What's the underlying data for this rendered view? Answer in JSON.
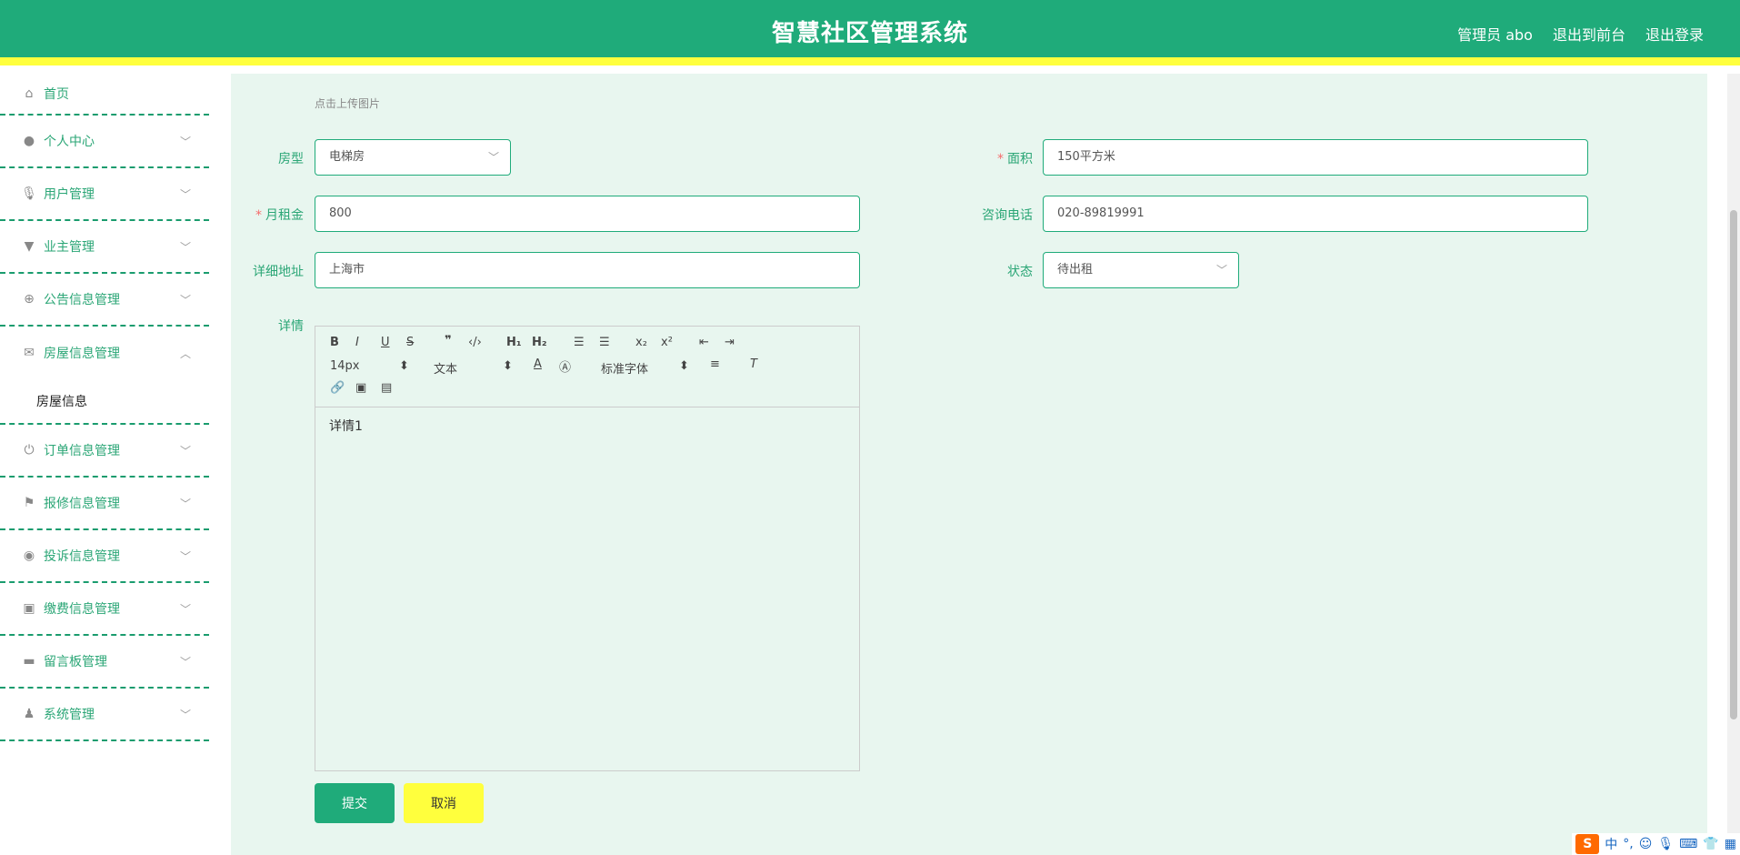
{
  "header": {
    "title": "智慧社区管理系统",
    "admin": "管理员 abo",
    "to_front": "退出到前台",
    "logout": "退出登录"
  },
  "sidebar": {
    "items": [
      {
        "label": "首页",
        "icon": "home-icon"
      },
      {
        "label": "个人中心",
        "icon": "user-icon"
      },
      {
        "label": "用户管理",
        "icon": "mic-icon"
      },
      {
        "label": "业主管理",
        "icon": "stamp-icon"
      },
      {
        "label": "公告信息管理",
        "icon": "target-icon"
      },
      {
        "label": "房屋信息管理",
        "icon": "mail-icon",
        "expanded": true,
        "sub": "房屋信息"
      },
      {
        "label": "订单信息管理",
        "icon": "power-icon"
      },
      {
        "label": "报修信息管理",
        "icon": "flag-icon"
      },
      {
        "label": "投诉信息管理",
        "icon": "location-icon"
      },
      {
        "label": "缴费信息管理",
        "icon": "clipboard-icon"
      },
      {
        "label": "留言板管理",
        "icon": "monitor-icon"
      },
      {
        "label": "系统管理",
        "icon": "person-icon"
      }
    ]
  },
  "form": {
    "upload_tip": "点击上传图片",
    "house_type_label": "房型",
    "house_type_value": "电梯房",
    "area_label": "面积",
    "area_value": "150平方米",
    "rent_label": "月租金",
    "rent_value": "800",
    "phone_label": "咨询电话",
    "phone_value": "020-89819991",
    "address_label": "详细地址",
    "address_value": "上海市",
    "status_label": "状态",
    "status_value": "待出租",
    "detail_label": "详情",
    "detail_value": "详情1",
    "submit": "提交",
    "cancel": "取消"
  },
  "editor": {
    "font_size": "14px",
    "paragraph": "文本",
    "font_family": "标准字体"
  },
  "tray": {
    "lang": "中"
  },
  "colors": {
    "primary": "#1fab7a",
    "accent": "#ffff3d",
    "background": "#e8f6ef"
  }
}
